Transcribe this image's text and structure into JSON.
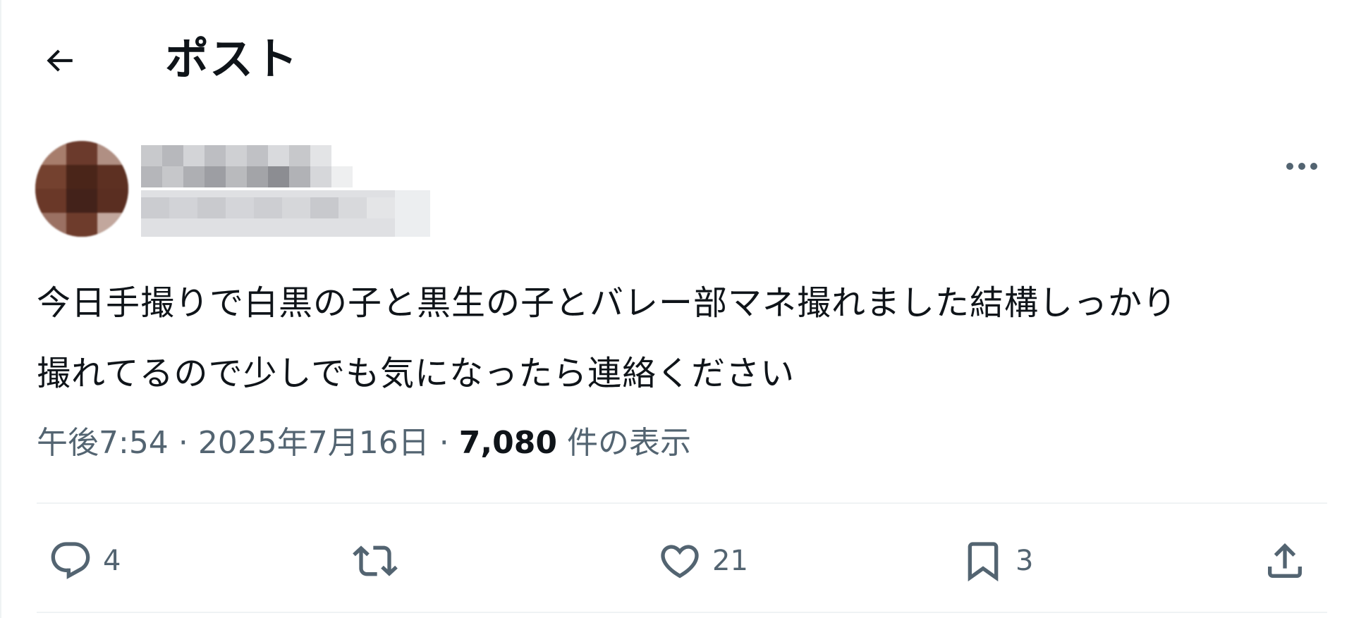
{
  "header": {
    "title": "ポスト",
    "back_icon": "back-arrow-icon"
  },
  "author": {
    "avatar": "blurred-avatar",
    "display_name": "",
    "handle": "",
    "more_icon": "more-options-icon"
  },
  "post": {
    "text": "今日手撮りで白黒の子と黒生の子とバレー部マネ撮れました結構しっかり\n撮れてるので少しでも気になったら連絡ください",
    "time": "午後7:54",
    "separator": "·",
    "date": "2025年7月16日",
    "views_count": "7,080",
    "views_label": "件の表示"
  },
  "actions": {
    "reply": {
      "icon": "reply-icon",
      "count": "4"
    },
    "retweet": {
      "icon": "retweet-icon",
      "count": ""
    },
    "like": {
      "icon": "heart-icon",
      "count": "21"
    },
    "bookmark": {
      "icon": "bookmark-icon",
      "count": "3"
    },
    "share": {
      "icon": "share-icon",
      "count": ""
    }
  },
  "colors": {
    "text": "#0f1419",
    "secondary": "#536471",
    "divider": "#eff3f4",
    "avatar": "#5b3326"
  }
}
